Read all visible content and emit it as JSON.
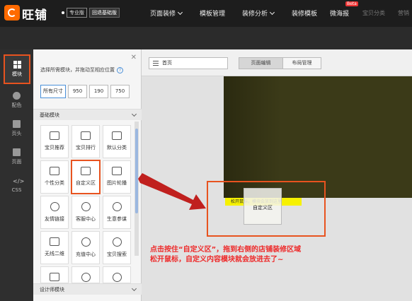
{
  "topbar": {
    "logo_text": "旺铺",
    "badge_pro": "专业版",
    "badge_back": "回退基础版",
    "nav": [
      {
        "label": "页面装修",
        "has_menu": true
      },
      {
        "label": "模板管理",
        "has_menu": false
      },
      {
        "label": "装修分析",
        "has_menu": true
      },
      {
        "label": "装修模板",
        "has_menu": false
      },
      {
        "label": "微海报",
        "has_menu": false
      },
      {
        "label": "宝贝分类",
        "has_menu": false
      },
      {
        "label": "营销",
        "has_menu": false
      }
    ],
    "beta_label": "Beta"
  },
  "sidebar": {
    "items": [
      {
        "label": "模块",
        "icon": "grid-icon",
        "active": true
      },
      {
        "label": "配色",
        "icon": "palette-icon",
        "active": false
      },
      {
        "label": "页头",
        "icon": "header-icon",
        "active": false
      },
      {
        "label": "页面",
        "icon": "page-icon",
        "active": false
      },
      {
        "label": "CSS",
        "icon": "code-icon",
        "active": false
      }
    ]
  },
  "panel": {
    "tip": "选择所需模块，并拖动至相应位置",
    "sizes": [
      "所有尺寸",
      "950",
      "190",
      "750"
    ],
    "selected_size": "所有尺寸",
    "basic_group": "基础模块",
    "designer_group": "设计师模块",
    "modules": [
      {
        "label": "宝贝推荐",
        "icon": "image-icon"
      },
      {
        "label": "宝贝排行",
        "icon": "sort-icon"
      },
      {
        "label": "默认分类",
        "icon": "category-icon"
      },
      {
        "label": "个性分类",
        "icon": "tree-icon"
      },
      {
        "label": "自定义区",
        "icon": "custom-grid-icon",
        "highlighted": true
      },
      {
        "label": "图片轮播",
        "icon": "carousel-icon"
      },
      {
        "label": "友情链接",
        "icon": "link-icon"
      },
      {
        "label": "客服中心",
        "icon": "service-icon"
      },
      {
        "label": "生意参谋",
        "icon": "compass-icon"
      },
      {
        "label": "无线二维",
        "icon": "qrcode-icon"
      },
      {
        "label": "充值中心",
        "icon": "dollar-icon"
      },
      {
        "label": "宝贝搜索",
        "icon": "search-icon"
      },
      {
        "label": "",
        "icon": "gamepad-icon"
      },
      {
        "label": "",
        "icon": "play-icon"
      },
      {
        "label": "",
        "icon": "heart-icon"
      }
    ]
  },
  "editor": {
    "page_select": "首页",
    "tabs": [
      "页面编辑",
      "布局管理"
    ],
    "active_tab": "页面编辑",
    "drop_hint": "松开鼠标，模块会放到这里",
    "drag_ghost": "自定义区"
  },
  "annotation": {
    "line1": "点击按住“自定义区”，拖到右侧的店铺装修区域",
    "line2": "松开鼠标，自定义内容模块就会放进去了~",
    "color": "#ee2a2a"
  }
}
